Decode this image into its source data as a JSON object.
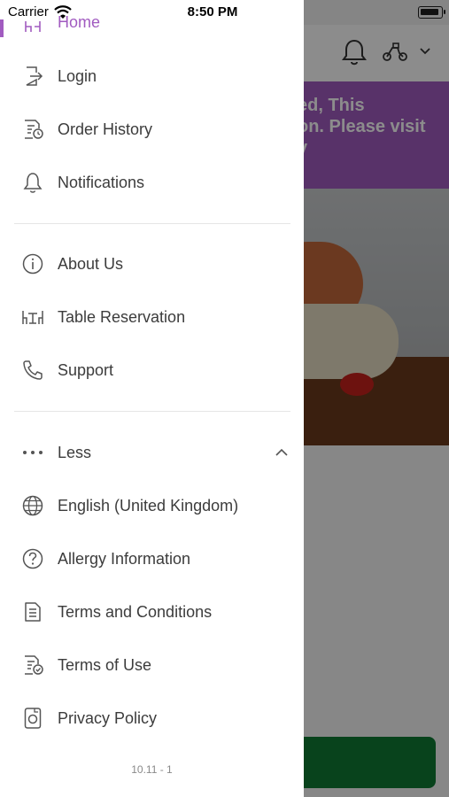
{
  "status_bar": {
    "carrier": "Carrier",
    "time": "8:50 PM"
  },
  "background": {
    "banner_line1": "ed, This",
    "banner_line2": "on. Please visit",
    "banner_line3": "y"
  },
  "drawer": {
    "home_label": "Home",
    "items": [
      {
        "label": "Login",
        "icon": "login-icon"
      },
      {
        "label": "Order History",
        "icon": "order-history-icon"
      },
      {
        "label": "Notifications",
        "icon": "bell-icon"
      },
      {
        "label": "About Us",
        "icon": "info-icon"
      },
      {
        "label": "Table Reservation",
        "icon": "table-icon"
      },
      {
        "label": "Support",
        "icon": "phone-icon"
      },
      {
        "label": "Less",
        "icon": "more-dots-icon"
      },
      {
        "label": "English (United Kingdom)",
        "icon": "globe-icon"
      },
      {
        "label": "Allergy Information",
        "icon": "question-icon"
      },
      {
        "label": "Terms and Conditions",
        "icon": "document-icon"
      },
      {
        "label": "Terms of Use",
        "icon": "document-check-icon"
      },
      {
        "label": "Privacy Policy",
        "icon": "privacy-icon"
      }
    ],
    "version": "10.11 - 1"
  },
  "colors": {
    "accent": "#a15bc0",
    "cta": "#0f7a33",
    "text": "#3c3c3c"
  }
}
